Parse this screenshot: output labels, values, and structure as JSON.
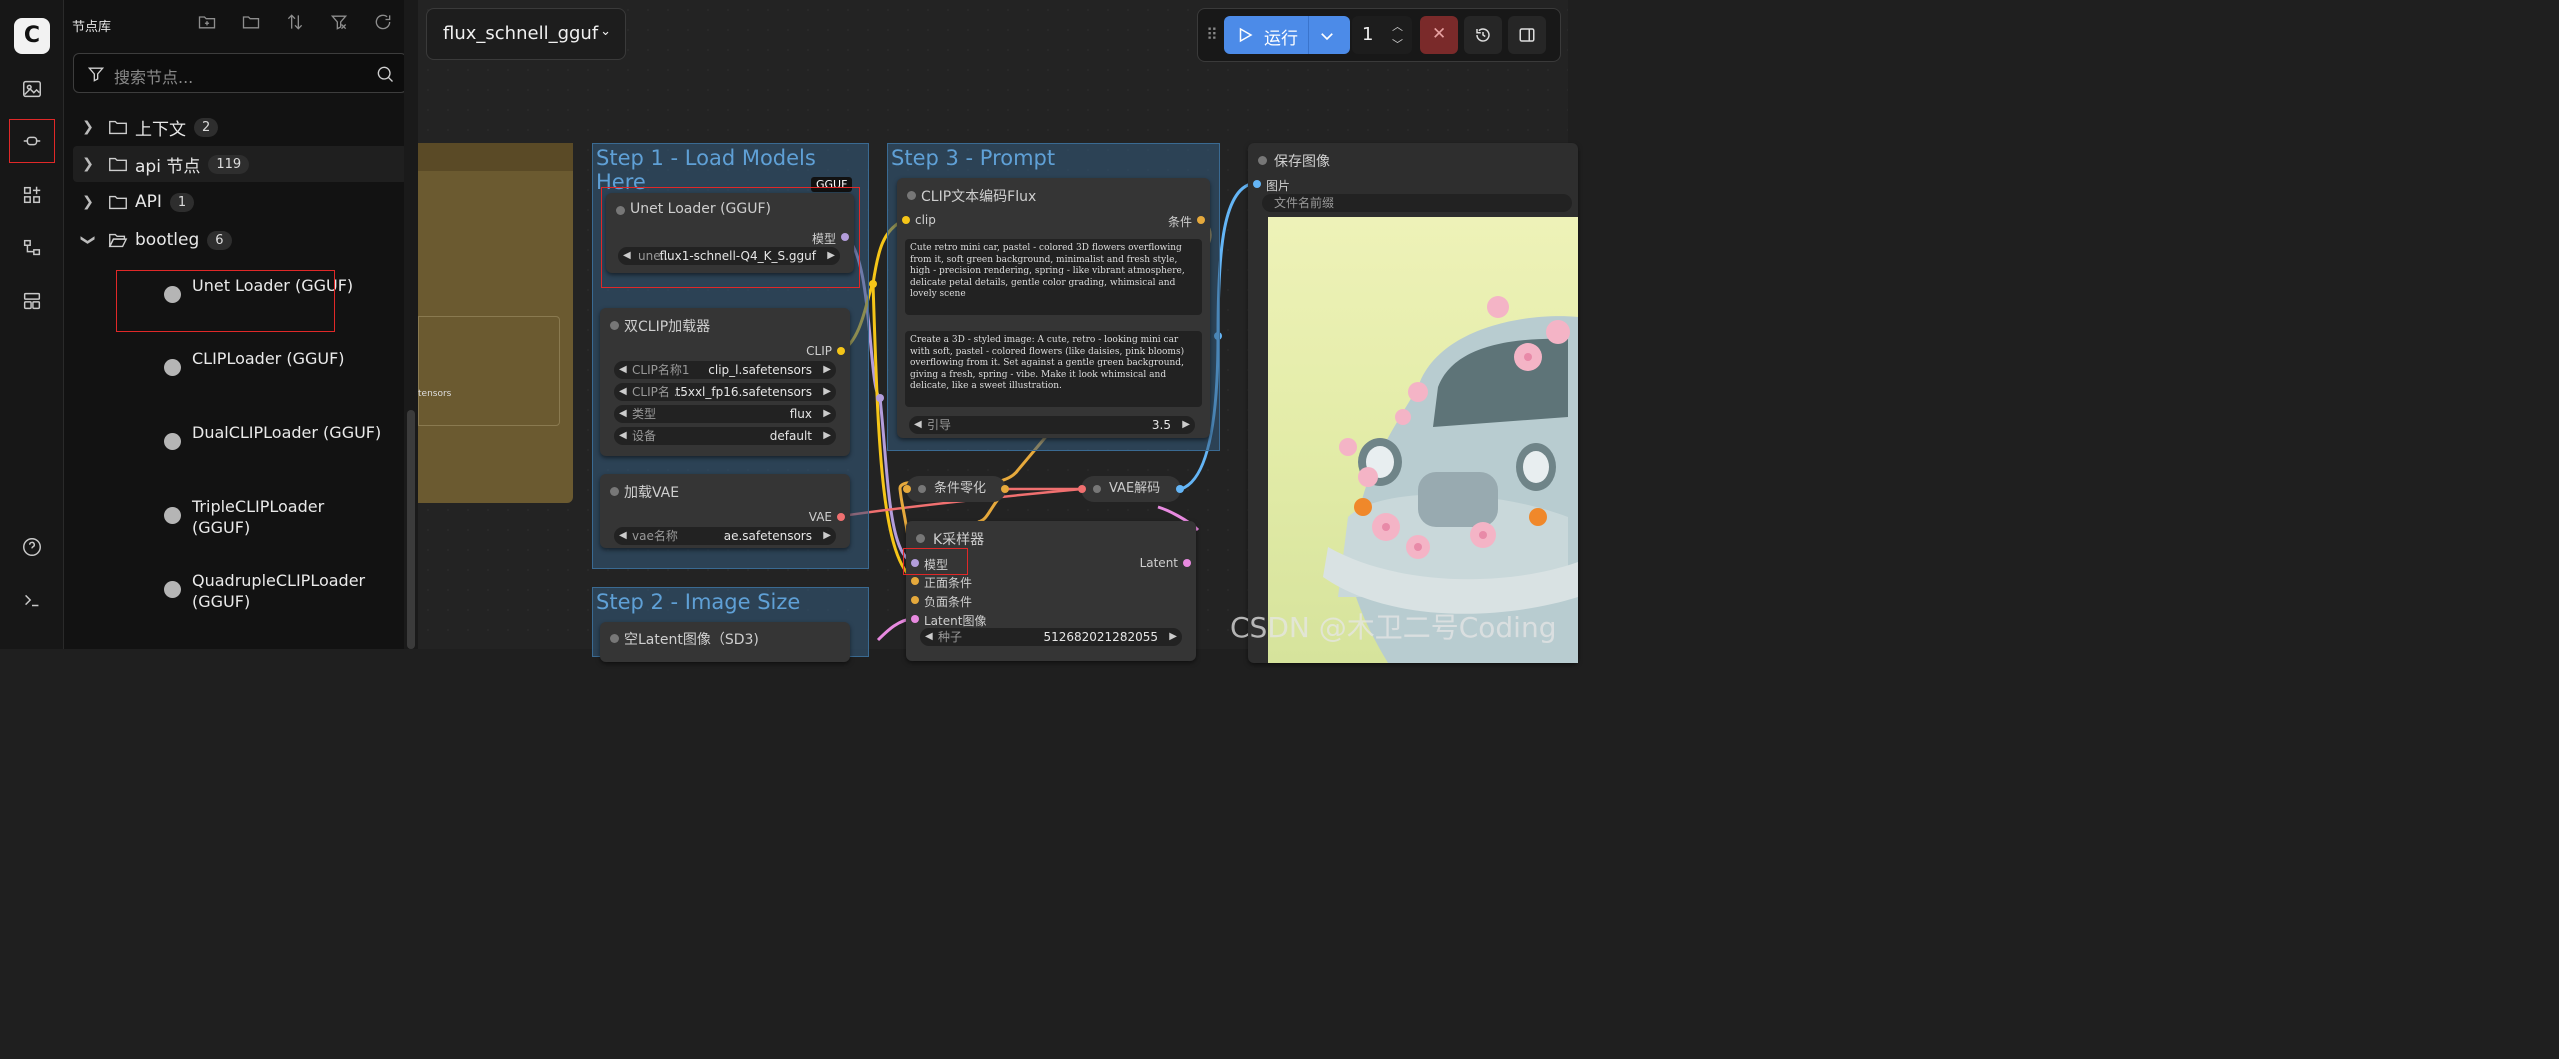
{
  "sidebar": {
    "title": "节点库",
    "search_placeholder": "搜索节点...",
    "folders": [
      {
        "label": "上下文",
        "count": "2"
      },
      {
        "label": "api 节点",
        "count": "119"
      },
      {
        "label": "API",
        "count": "1"
      },
      {
        "label": "bootleg",
        "count": "6"
      }
    ],
    "leaves": [
      "Unet Loader (GGUF)",
      "CLIPLoader (GGUF)",
      "DualCLIPLoader (GGUF)",
      "TripleCLIPLoader (GGUF)",
      "QuadrupleCLIPLoader (GGUF)"
    ]
  },
  "toolbar": {
    "workflow_name": "flux_schnell_gguf",
    "run_label": "运行",
    "batch_count": "1"
  },
  "groups": {
    "step1": "Step 1 - Load Models Here",
    "step2": "Step 2 - Image Size",
    "step3": "Step 3 - Prompt"
  },
  "nodes": {
    "unet": {
      "badge": "GGUF",
      "title": "Unet Loader (GGUF)",
      "out": "模型",
      "w_label": "une...",
      "w_value": "flux1-schnell-Q4_K_S.gguf"
    },
    "dualclip": {
      "title": "双CLIP加载器",
      "out": "CLIP",
      "widgets": [
        {
          "label": "CLIP名称1",
          "value": "clip_l.safetensors"
        },
        {
          "label": "CLIP名 ...",
          "value": "t5xxl_fp16.safetensors"
        },
        {
          "label": "类型",
          "value": "flux"
        },
        {
          "label": "设备",
          "value": "default"
        }
      ]
    },
    "vae": {
      "title": "加载VAE",
      "out": "VAE",
      "w_label": "vae名称",
      "w_value": "ae.safetensors"
    },
    "latent": {
      "title": "空Latent图像（SD3)"
    },
    "clipenc": {
      "title": "CLIP文本编码Flux",
      "in": "clip",
      "out": "条件",
      "prompt1": "Cute retro mini car, pastel - colored 3D flowers overflowing from it, soft green background, minimalist and fresh style, high - precision rendering, spring - like vibrant atmosphere, delicate petal details, gentle color grading, whimsical and lovely scene",
      "prompt2": "Create a 3D - styled image: A cute, retro - looking mini car with soft, pastel - colored flowers (like daisies, pink blooms) overflowing from it. Set against a gentle green background, giving a fresh, spring - vibe. Make it look whimsical and delicate, like a sweet illustration.",
      "guidance_label": "引导",
      "guidance_value": "3.5"
    },
    "zero": {
      "title": "条件零化"
    },
    "vaedecode": {
      "title": "VAE解码"
    },
    "ksampler": {
      "title": "K采样器",
      "inputs": [
        "模型",
        "正面条件",
        "负面条件",
        "Latent图像"
      ],
      "out": "Latent",
      "seed_label": "种子",
      "seed_value": "512682021282055"
    },
    "save": {
      "title": "保存图像",
      "in": "图片",
      "prefix": "文件名前缀"
    },
    "left_partial": {
      "text": "tensors"
    }
  },
  "watermark": "CSDN @木卫二号Coding",
  "colors": {
    "accent": "#4c8be8",
    "highlight": "#e02828",
    "group": "#345d80",
    "clip_wire": "#f5c518",
    "vae_wire": "#f07070",
    "model_wire": "#b39ddb"
  }
}
